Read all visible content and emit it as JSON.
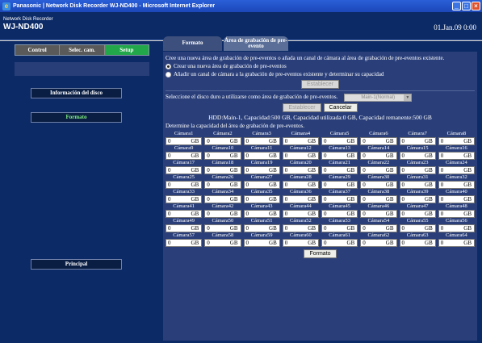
{
  "window": {
    "title": "Panasonic | Network Disk Recorder WJ-ND400 - Microsoft Internet Explorer"
  },
  "header": {
    "subtitle": "Network Disk Recorder",
    "model": "WJ-ND400",
    "datetime": "01.Jan.09  0:00"
  },
  "nav": {
    "tabs": [
      "Control",
      "Selec. cam.",
      "Setup"
    ],
    "active": "Setup"
  },
  "sidebar": {
    "disk_info_label": "Información del disco",
    "format_label": "Formato",
    "main_label": "Principal"
  },
  "content_tabs": [
    {
      "label": "Formato",
      "active": false
    },
    {
      "label": "Área de grabación de pre-evento",
      "active": true
    }
  ],
  "panel": {
    "intro": "Cree una nueva área de grabación de pre-eventos o añada un canal de cámara al área de grabación de pre-eventos existente.",
    "option_create": "Crear una nueva área de grabación de pre-eventos",
    "option_add": "Añadir un canal de cámara a la grabación de pre-eventos existente y determinar su capacidad",
    "set_button_1": "Establecer",
    "disk_prompt": "Seleccione el disco duro a utilizarse como área de grabación de pre-eventos.",
    "disk_select": "Main-1(Normal)",
    "set_button_2": "Establecer",
    "cancel_button": "Cancelar",
    "hdd_info": "HDD:Main-1,  Capacidad:500 GB,  Capacidad utilizada:0 GB,  Capacidad remanente:500 GB",
    "capacity_prompt": "Determine la capacidad del área de grabación de pre-eventos.",
    "unit": "GB",
    "format_button": "Formato"
  },
  "cameras": [
    {
      "label": "Cámara1",
      "value": "0"
    },
    {
      "label": "Cámara2",
      "value": "0"
    },
    {
      "label": "Cámara3",
      "value": "0"
    },
    {
      "label": "Cámara4",
      "value": "0"
    },
    {
      "label": "Cámara5",
      "value": "0"
    },
    {
      "label": "Cámara6",
      "value": "0"
    },
    {
      "label": "Cámara7",
      "value": "0"
    },
    {
      "label": "Cámara8",
      "value": "0"
    },
    {
      "label": "Cámara9",
      "value": "0"
    },
    {
      "label": "Cámara10",
      "value": "0"
    },
    {
      "label": "Cámara11",
      "value": "0"
    },
    {
      "label": "Cámara12",
      "value": "0"
    },
    {
      "label": "Cámara13",
      "value": "0"
    },
    {
      "label": "Cámara14",
      "value": "0"
    },
    {
      "label": "Cámara15",
      "value": "0"
    },
    {
      "label": "Cámara16",
      "value": "0"
    },
    {
      "label": "Cámara17",
      "value": "0"
    },
    {
      "label": "Cámara18",
      "value": "0"
    },
    {
      "label": "Cámara19",
      "value": "0"
    },
    {
      "label": "Cámara20",
      "value": "0"
    },
    {
      "label": "Cámara21",
      "value": "0"
    },
    {
      "label": "Cámara22",
      "value": "0"
    },
    {
      "label": "Cámara23",
      "value": "0"
    },
    {
      "label": "Cámara24",
      "value": "0"
    },
    {
      "label": "Cámara25",
      "value": "0"
    },
    {
      "label": "Cámara26",
      "value": "0"
    },
    {
      "label": "Cámara27",
      "value": "0"
    },
    {
      "label": "Cámara28",
      "value": "0"
    },
    {
      "label": "Cámara29",
      "value": "0"
    },
    {
      "label": "Cámara30",
      "value": "0"
    },
    {
      "label": "Cámara31",
      "value": "0"
    },
    {
      "label": "Cámara32",
      "value": "0"
    },
    {
      "label": "Cámara33",
      "value": "0"
    },
    {
      "label": "Cámara34",
      "value": "0"
    },
    {
      "label": "Cámara35",
      "value": "0"
    },
    {
      "label": "Cámara36",
      "value": "0"
    },
    {
      "label": "Cámara37",
      "value": "0"
    },
    {
      "label": "Cámara38",
      "value": "0"
    },
    {
      "label": "Cámara39",
      "value": "0"
    },
    {
      "label": "Cámara40",
      "value": "0"
    },
    {
      "label": "Cámara41",
      "value": "0"
    },
    {
      "label": "Cámara42",
      "value": "0"
    },
    {
      "label": "Cámara43",
      "value": "0"
    },
    {
      "label": "Cámara44",
      "value": "0"
    },
    {
      "label": "Cámara45",
      "value": "0"
    },
    {
      "label": "Cámara46",
      "value": "0"
    },
    {
      "label": "Cámara47",
      "value": "0"
    },
    {
      "label": "Cámara48",
      "value": "0"
    },
    {
      "label": "Cámara49",
      "value": "0"
    },
    {
      "label": "Cámara50",
      "value": "0"
    },
    {
      "label": "Cámara51",
      "value": "0"
    },
    {
      "label": "Cámara52",
      "value": "0"
    },
    {
      "label": "Cámara53",
      "value": "0"
    },
    {
      "label": "Cámara54",
      "value": "0"
    },
    {
      "label": "Cámara55",
      "value": "0"
    },
    {
      "label": "Cámara56",
      "value": "0"
    },
    {
      "label": "Cámara57",
      "value": "0"
    },
    {
      "label": "Cámara58",
      "value": "0"
    },
    {
      "label": "Cámara59",
      "value": "0"
    },
    {
      "label": "Cámara60",
      "value": "0"
    },
    {
      "label": "Cámara61",
      "value": "0"
    },
    {
      "label": "Cámara62",
      "value": "0"
    },
    {
      "label": "Cámara63",
      "value": "0"
    },
    {
      "label": "Cámara64",
      "value": "0"
    }
  ]
}
